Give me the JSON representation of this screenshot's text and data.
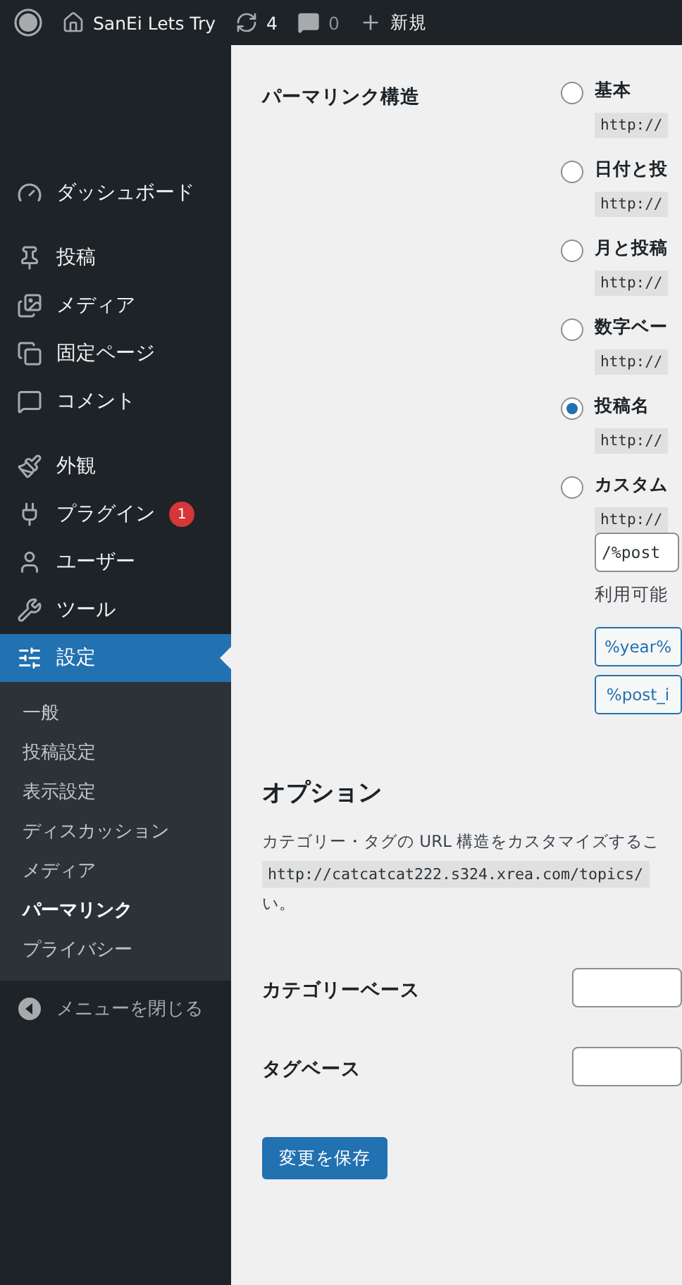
{
  "admin_bar": {
    "site_name": "SanEi Lets Try",
    "updates_count": "4",
    "comments_count": "0",
    "new_label": "新規"
  },
  "sidebar": {
    "groups": [
      [
        {
          "label": "ダッシュボード",
          "selected": false
        }
      ],
      [
        {
          "label": "投稿",
          "selected": false
        },
        {
          "label": "メディア",
          "selected": false
        },
        {
          "label": "固定ページ",
          "selected": false
        },
        {
          "label": "コメント",
          "selected": false
        }
      ],
      [
        {
          "label": "外観",
          "selected": false
        },
        {
          "label": "プラグイン",
          "selected": false,
          "badge": "1"
        },
        {
          "label": "ユーザー",
          "selected": false
        },
        {
          "label": "ツール",
          "selected": false
        },
        {
          "label": "設定",
          "selected": true
        }
      ]
    ],
    "submenu": [
      {
        "label": "一般",
        "selected": false
      },
      {
        "label": "投稿設定",
        "selected": false
      },
      {
        "label": "表示設定",
        "selected": false
      },
      {
        "label": "ディスカッション",
        "selected": false
      },
      {
        "label": "メディア",
        "selected": false
      },
      {
        "label": "パーマリンク",
        "selected": true
      },
      {
        "label": "プライバシー",
        "selected": false
      }
    ],
    "collapse_label": "メニューを閉じる"
  },
  "permalink": {
    "label": "パーマリンク構造",
    "options": [
      {
        "kind": "preset",
        "label": "基本",
        "selected": false,
        "example": "http://"
      },
      {
        "kind": "preset",
        "label": "日付と投",
        "selected": false,
        "example": "http://"
      },
      {
        "kind": "preset",
        "label": "月と投稿",
        "selected": false,
        "example": "http://"
      },
      {
        "kind": "preset",
        "label": "数字ベー",
        "selected": false,
        "example": "http://"
      },
      {
        "kind": "preset",
        "label": "投稿名",
        "selected": true,
        "example": "http://"
      },
      {
        "kind": "custom",
        "label": "カスタム",
        "selected": false,
        "example": "http://",
        "value": "/%post",
        "available_label": "利用可能",
        "tags": [
          "%year%",
          "%post_i"
        ]
      }
    ]
  },
  "options": {
    "title": "オプション",
    "description": "カテゴリー・タグの URL 構造をカスタマイズするこ",
    "description_code": "http://catcatcat222.s324.xrea.com/topics/",
    "description_end": "い。",
    "fields": [
      {
        "label": "カテゴリーベース"
      },
      {
        "label": "タグベース"
      }
    ]
  },
  "save_button": "変更を保存"
}
